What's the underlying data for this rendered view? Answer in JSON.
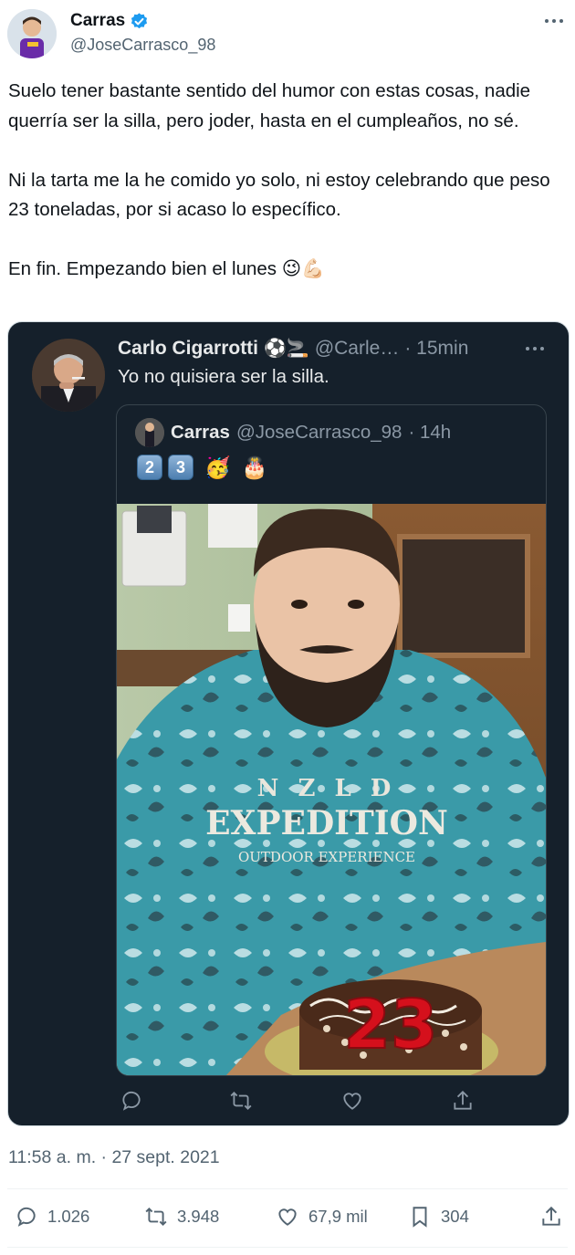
{
  "author": {
    "display_name": "Carras",
    "handle": "@JoseCarrasco_98",
    "verified": true
  },
  "tweet": {
    "text": "Suelo tener bastante sentido del humor con estas cosas, nadie querría ser la silla, pero joder, hasta en el cumpleaños, no sé.\n\nNi la tarta me la he comido yo solo, ni estoy celebrando que peso 23 toneladas, por si acaso lo específico.\n\nEn fin. Empezando bien el lunes 😉💪🏻",
    "timestamp": "11:58 a. m. · 27 sept. 2021"
  },
  "embedded": {
    "display_name": "Carlo Cigarrotti",
    "name_emojis": "⚽🚬",
    "handle": "@Carle…",
    "time": "· 15min",
    "text": "Yo no quisiera ser la silla.",
    "quoted": {
      "display_name": "Carras",
      "handle": "@JoseCarrasco_98",
      "time": "· 14h",
      "keycap_1": "2",
      "keycap_2": "3",
      "emoji_face": "🥳",
      "emoji_cake": "🎂",
      "photo_text_line1": "N Z L D",
      "photo_text_line2": "EXPEDITION",
      "photo_text_line3": "OUTDOOR EXPERIENCE",
      "cake_number": "23"
    }
  },
  "stats": {
    "replies": "1.026",
    "retweets": "3.948",
    "likes": "67,9 mil",
    "bookmarks": "304"
  },
  "colors": {
    "card_bg": "#15202b",
    "text_primary": "#0f1419",
    "text_secondary": "#536471",
    "verified_blue": "#1d9bf0"
  }
}
